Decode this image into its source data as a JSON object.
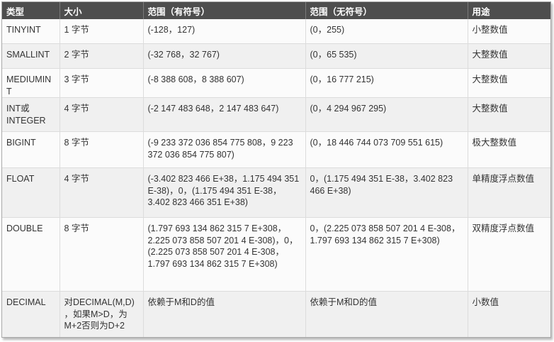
{
  "header": {
    "type": "类型",
    "size": "大小",
    "signed_range": "范围（有符号）",
    "unsigned_range": "范围（无符号）",
    "usage": "用途"
  },
  "rows": [
    {
      "type": "TINYINT",
      "size": "1 字节",
      "signed": "(-128，127)",
      "unsigned": "(0，255)",
      "usage": "小整数值"
    },
    {
      "type": "SMALLINT",
      "size": "2 字节",
      "signed": "(-32 768，32 767)",
      "unsigned": "(0，65 535)",
      "usage": "大整数值"
    },
    {
      "type": "MEDIUMINT",
      "size": "3 字节",
      "signed": "(-8 388 608，8 388 607)",
      "unsigned": "(0，16 777 215)",
      "usage": "大整数值"
    },
    {
      "type": "INT或INTEGER",
      "size": "4 字节",
      "signed": "(-2 147 483 648，2 147 483 647)",
      "unsigned": "(0，4 294 967 295)",
      "usage": "大整数值"
    },
    {
      "type": "BIGINT",
      "size": "8 字节",
      "signed": "(-9 233 372 036 854 775 808，9 223 372 036 854 775 807)",
      "unsigned": "(0，18 446 744 073 709 551 615)",
      "usage": "极大整数值"
    },
    {
      "type": "FLOAT",
      "size": "4 字节",
      "signed": "(-3.402 823 466 E+38，1.175 494 351 E-38)，0，(1.175 494 351 E-38，3.402 823 466 351 E+38)",
      "unsigned": "0，(1.175 494 351 E-38，3.402 823 466 E+38)",
      "usage": "单精度浮点数值"
    },
    {
      "type": "DOUBLE",
      "size": "8 字节",
      "signed": "(1.797 693 134 862 315 7 E+308，2.225 073 858 507 201 4 E-308)，0，(2.225 073 858 507 201 4 E-308，1.797 693 134 862 315 7 E+308)",
      "unsigned": "0，(2.225 073 858 507 201 4 E-308，1.797 693 134 862 315 7 E+308)",
      "usage": "双精度浮点数值"
    },
    {
      "type": "DECIMAL",
      "size": "对DECIMAL(M,D) ，如果M>D，为M+2否则为D+2",
      "signed": "依赖于M和D的值",
      "unsigned": "依赖于M和D的值",
      "usage": "小数值"
    }
  ]
}
